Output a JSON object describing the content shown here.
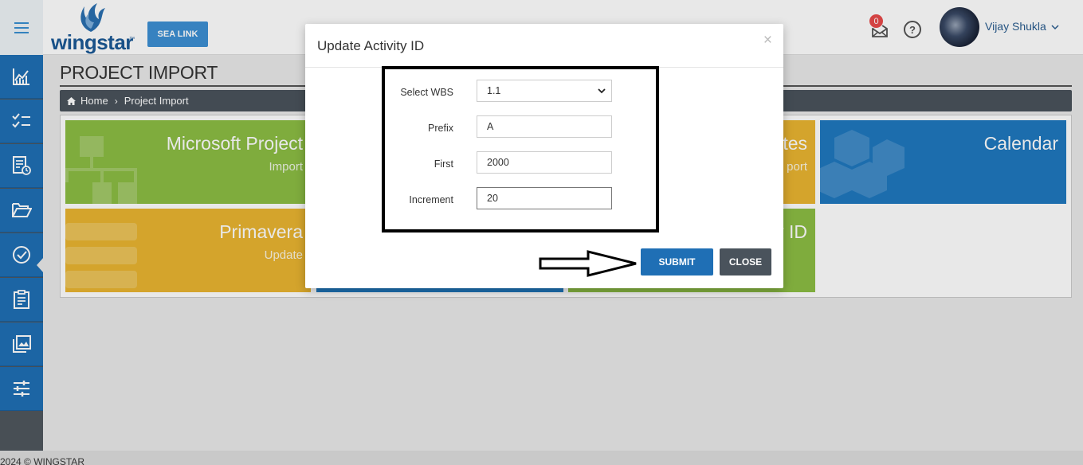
{
  "header": {
    "logo_text": "wingstar",
    "logo_tm": "™",
    "sea_link_label": "SEA LINK",
    "notification_count": "0",
    "help_glyph": "?",
    "user_name": "Vijay Shukla"
  },
  "sidebar": {
    "items": [
      {
        "icon": "chart-line-icon"
      },
      {
        "icon": "checklist-icon"
      },
      {
        "icon": "report-clock-icon"
      },
      {
        "icon": "folder-open-icon",
        "active": true
      },
      {
        "icon": "check-circle-icon"
      },
      {
        "icon": "clipboard-icon"
      },
      {
        "icon": "images-icon"
      },
      {
        "icon": "sliders-icon"
      }
    ]
  },
  "page": {
    "title": "PROJECT IMPORT",
    "breadcrumb": {
      "home": "Home",
      "current": "Project Import"
    },
    "tiles": [
      {
        "title": "Microsoft Project",
        "subtitle": "Import",
        "color": "#8cbd44"
      },
      {
        "title": "tes",
        "subtitle": "port",
        "color": "#e9b531"
      },
      {
        "title": "Calendar",
        "subtitle": "",
        "color": "#1f78bf"
      },
      {
        "title": "Primavera",
        "subtitle": "Update",
        "color": "#e9b531"
      },
      {
        "title": "",
        "subtitle": "",
        "color": "#1f78bf"
      },
      {
        "title": "y ID",
        "subtitle": "",
        "color": "#8cbd44"
      }
    ]
  },
  "modal": {
    "title": "Update Activity ID",
    "close_glyph": "×",
    "fields": {
      "wbs_label": "Select WBS",
      "wbs_value": "1.1",
      "prefix_label": "Prefix",
      "prefix_value": "A",
      "first_label": "First",
      "first_value": "2000",
      "increment_label": "Increment",
      "increment_value": "20"
    },
    "submit_label": "SUBMIT",
    "close_label": "CLOSE"
  },
  "footer": {
    "copyright": "2024 © WINGSTAR"
  },
  "colors": {
    "primary": "#1f6fb5",
    "sidebar_bg": "#1f6fb5",
    "dark": "#4a535c",
    "green": "#8cbd44",
    "yellow": "#e9b531",
    "badge": "#e84a4a"
  }
}
